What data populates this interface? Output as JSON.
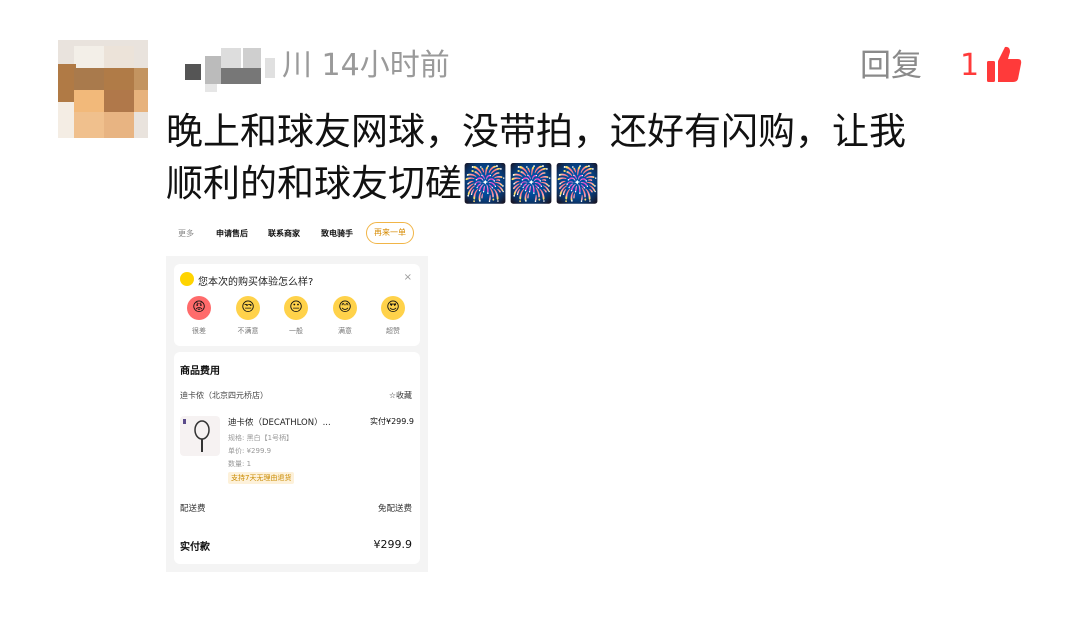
{
  "comment": {
    "username_tail": "川",
    "time": "14小时前",
    "reply_label": "回复",
    "like_count": "1",
    "text_line1": "晚上和球友网球，没带拍，还好有闪购，让我",
    "text_line2": "顺利的和球友切磋",
    "emojis": "🎆🎆🎆"
  },
  "order_screenshot": {
    "top_actions": [
      "更多",
      "申请售后",
      "联系商家",
      "致电骑手"
    ],
    "reorder_button": "再来一单",
    "survey": {
      "question": "您本次的购买体验怎么样?",
      "close": "×",
      "options": [
        {
          "label": "很差",
          "emoji": "😡"
        },
        {
          "label": "不满意",
          "emoji": "😒"
        },
        {
          "label": "一般",
          "emoji": "😐"
        },
        {
          "label": "满意",
          "emoji": "😊"
        },
        {
          "label": "超赞",
          "emoji": "😍"
        }
      ]
    },
    "cost_section": {
      "title": "商品费用",
      "store": "迪卡侬（北京四元桥店）",
      "favorite": "☆收藏",
      "product_name": "迪卡侬（DECATHLON）...",
      "product_price": "实付¥299.9",
      "spec": "规格: 黑白【1号柄】",
      "unit_price": "单价: ¥299.9",
      "quantity": "数量: 1",
      "return_tag": "支持7天无理由退货",
      "shipping_label": "配送费",
      "shipping_value": "免配送费"
    },
    "payment": {
      "label": "实付款",
      "value": "¥299.9"
    }
  },
  "colors": {
    "like_red": "#ff3a3a",
    "accent_orange": "#f1b547"
  }
}
